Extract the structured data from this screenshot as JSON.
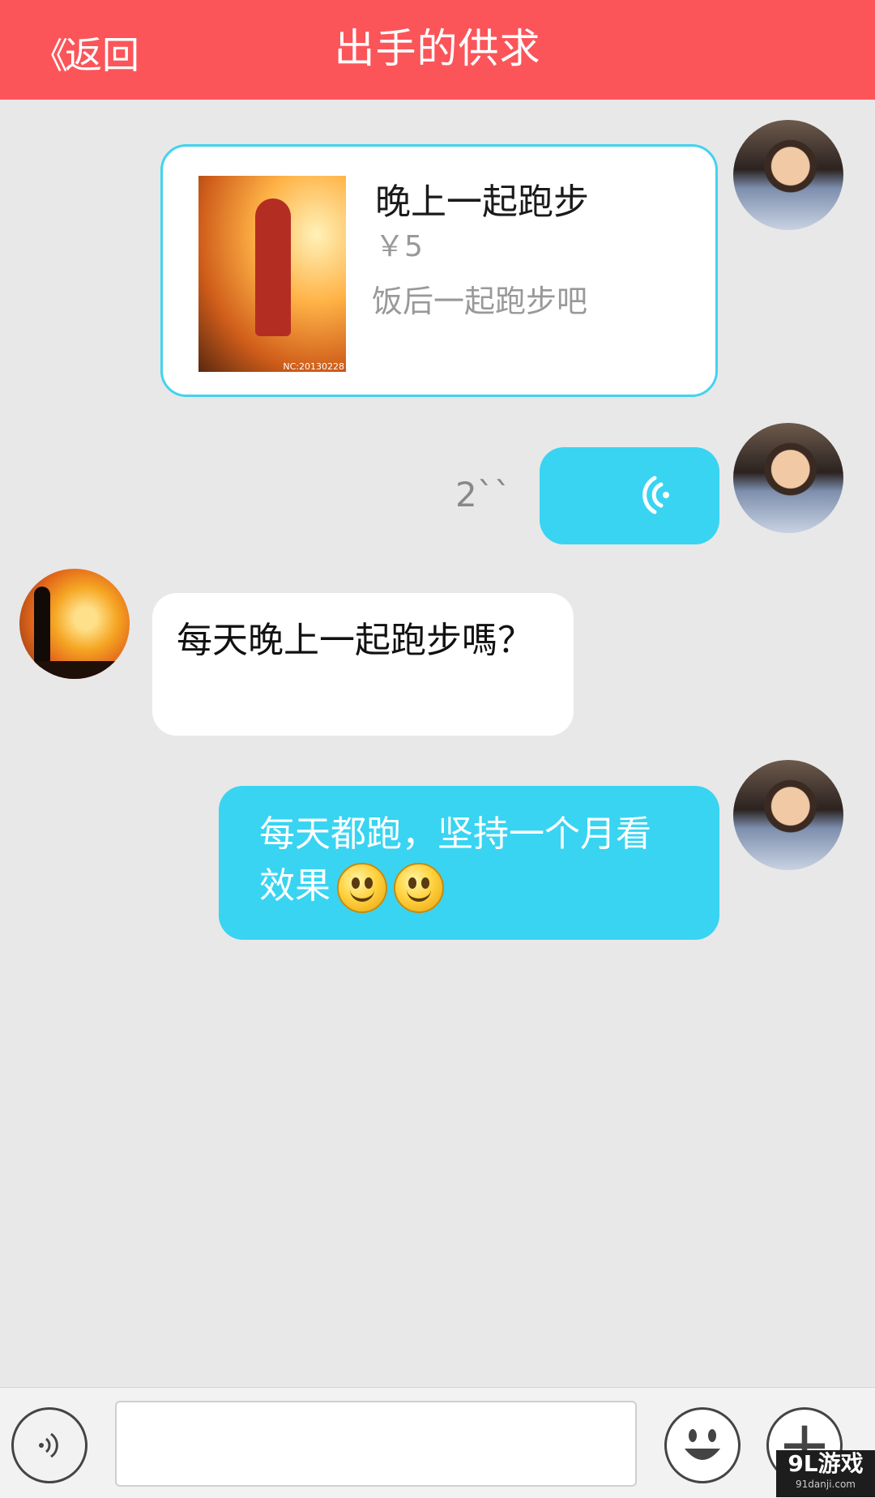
{
  "header": {
    "back_chevron": "《",
    "back_label": "返回",
    "title": "出手的供求"
  },
  "product_card": {
    "title": "晚上一起跑步",
    "price": "￥5",
    "description": "饭后一起跑步吧",
    "image_caption": "NC:20130228"
  },
  "voice_message": {
    "duration": "2``",
    "icon": "voice-wave-icon"
  },
  "messages": {
    "incoming": "每天晚上一起跑步嗎？",
    "outgoing": "每天都跑，坚持一个月看效果"
  },
  "input_bar": {
    "placeholder": "",
    "voice_icon": "voice-icon",
    "emoji_icon": "smiley-icon",
    "plus_icon": "plus-icon"
  },
  "watermark": {
    "main": "9L游戏",
    "sub": "91danji.com"
  },
  "colors": {
    "header": "#fb5559",
    "bubble_blue": "#39d4f1",
    "background": "#e8e8e8"
  }
}
